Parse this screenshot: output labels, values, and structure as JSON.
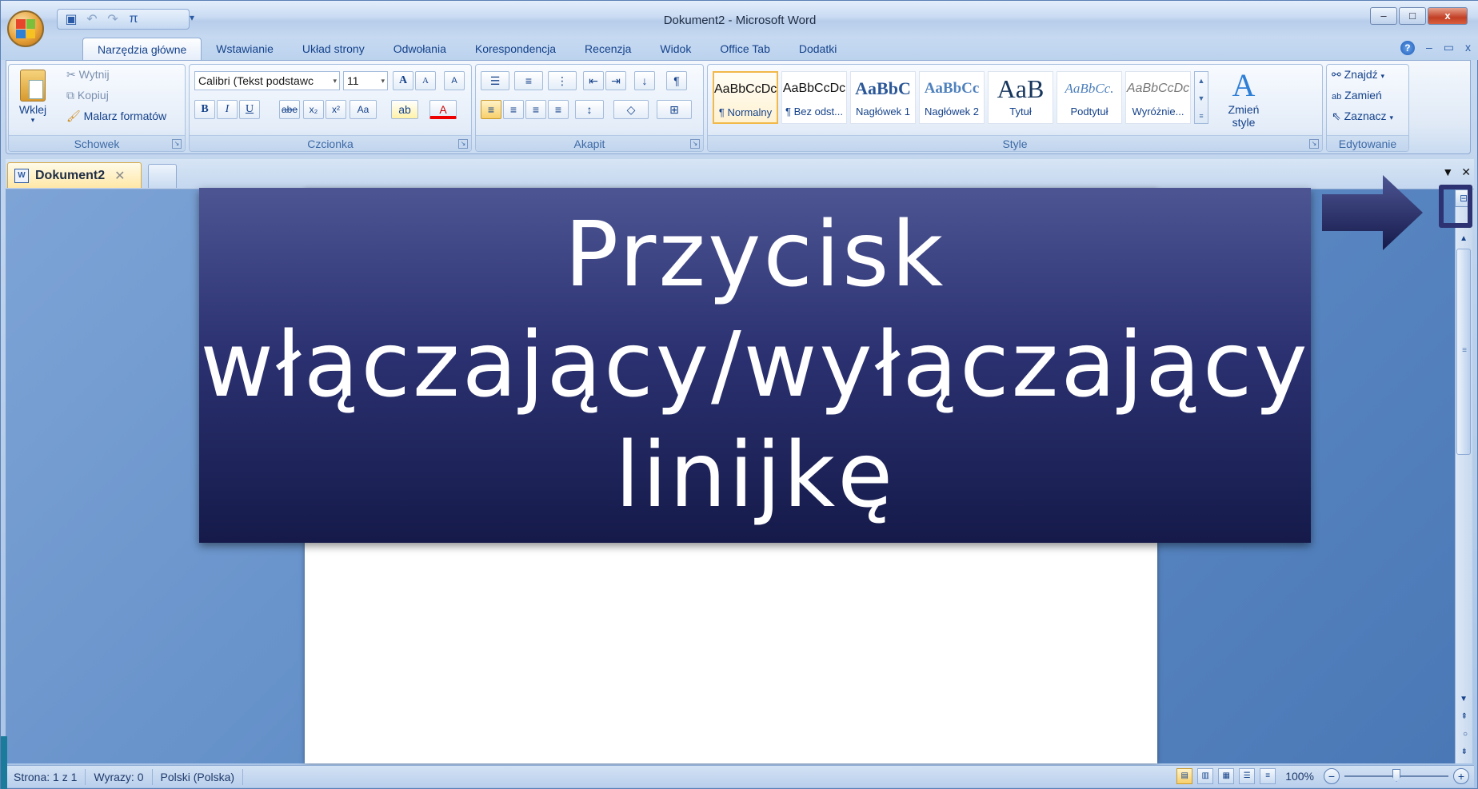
{
  "window": {
    "title": "Dokument2 - Microsoft Word",
    "controls": [
      "–",
      "□",
      "x"
    ]
  },
  "quick_access": {
    "items": [
      "save-icon",
      "undo-icon",
      "redo-icon",
      "pi-icon"
    ],
    "pi_label": "π"
  },
  "tabs": [
    {
      "label": "Narzędzia główne",
      "active": true
    },
    {
      "label": "Wstawianie"
    },
    {
      "label": "Układ strony"
    },
    {
      "label": "Odwołania"
    },
    {
      "label": "Korespondencja"
    },
    {
      "label": "Recenzja"
    },
    {
      "label": "Widok"
    },
    {
      "label": "Office Tab"
    },
    {
      "label": "Dodatki"
    }
  ],
  "tabs_right": {
    "help": "?",
    "minimize": "–",
    "restore": "▭",
    "close": "x"
  },
  "ribbon": {
    "clipboard": {
      "label": "Schowek",
      "paste": "Wklej",
      "cut": "Wytnij",
      "copy": "Kopiuj",
      "format_painter": "Malarz formatów"
    },
    "font": {
      "label": "Czcionka",
      "font_name": "Calibri (Tekst podstawc",
      "font_size": "11",
      "bold": "B",
      "italic": "I",
      "underline": "U",
      "strikethrough": "abe",
      "subscript": "x₂",
      "superscript": "x²",
      "change_case": "Aa",
      "grow": "A",
      "shrink": "A",
      "clear": "A"
    },
    "paragraph": {
      "label": "Akapit",
      "show_marks": "¶"
    },
    "styles": {
      "label": "Style",
      "items": [
        {
          "sample": "AaBbCcDc",
          "name": "¶ Normalny",
          "selected": true
        },
        {
          "sample": "AaBbCcDc",
          "name": "¶ Bez odst..."
        },
        {
          "sample": "AaBbC",
          "name": "Nagłówek 1"
        },
        {
          "sample": "AaBbCc",
          "name": "Nagłówek 2"
        },
        {
          "sample": "AaB",
          "name": "Tytuł"
        },
        {
          "sample": "AaBbCc.",
          "name": "Podtytuł"
        },
        {
          "sample": "AaBbCcDc",
          "name": "Wyróżnie..."
        }
      ],
      "change_styles": "Zmień style"
    },
    "editing": {
      "label": "Edytowanie",
      "find": "Znajdź",
      "replace": "Zamień",
      "select": "Zaznacz"
    }
  },
  "doc_tabs": {
    "active": "Dokument2",
    "close": "✕"
  },
  "status": {
    "page": "Strona: 1 z 1",
    "words": "Wyrazy: 0",
    "language": "Polski (Polska)",
    "zoom": "100%",
    "zoom_minus": "−",
    "zoom_plus": "+",
    "zoom_level": 0.5
  },
  "overlay": {
    "line1": "Przycisk",
    "line2": "włączający/wyłączający",
    "line3": "linijkę"
  },
  "colors": {
    "overlay_top": "#4d5593",
    "overlay_bottom": "#151a4a",
    "arrow": "#2c3272",
    "ribbon_text": "#15428b"
  }
}
